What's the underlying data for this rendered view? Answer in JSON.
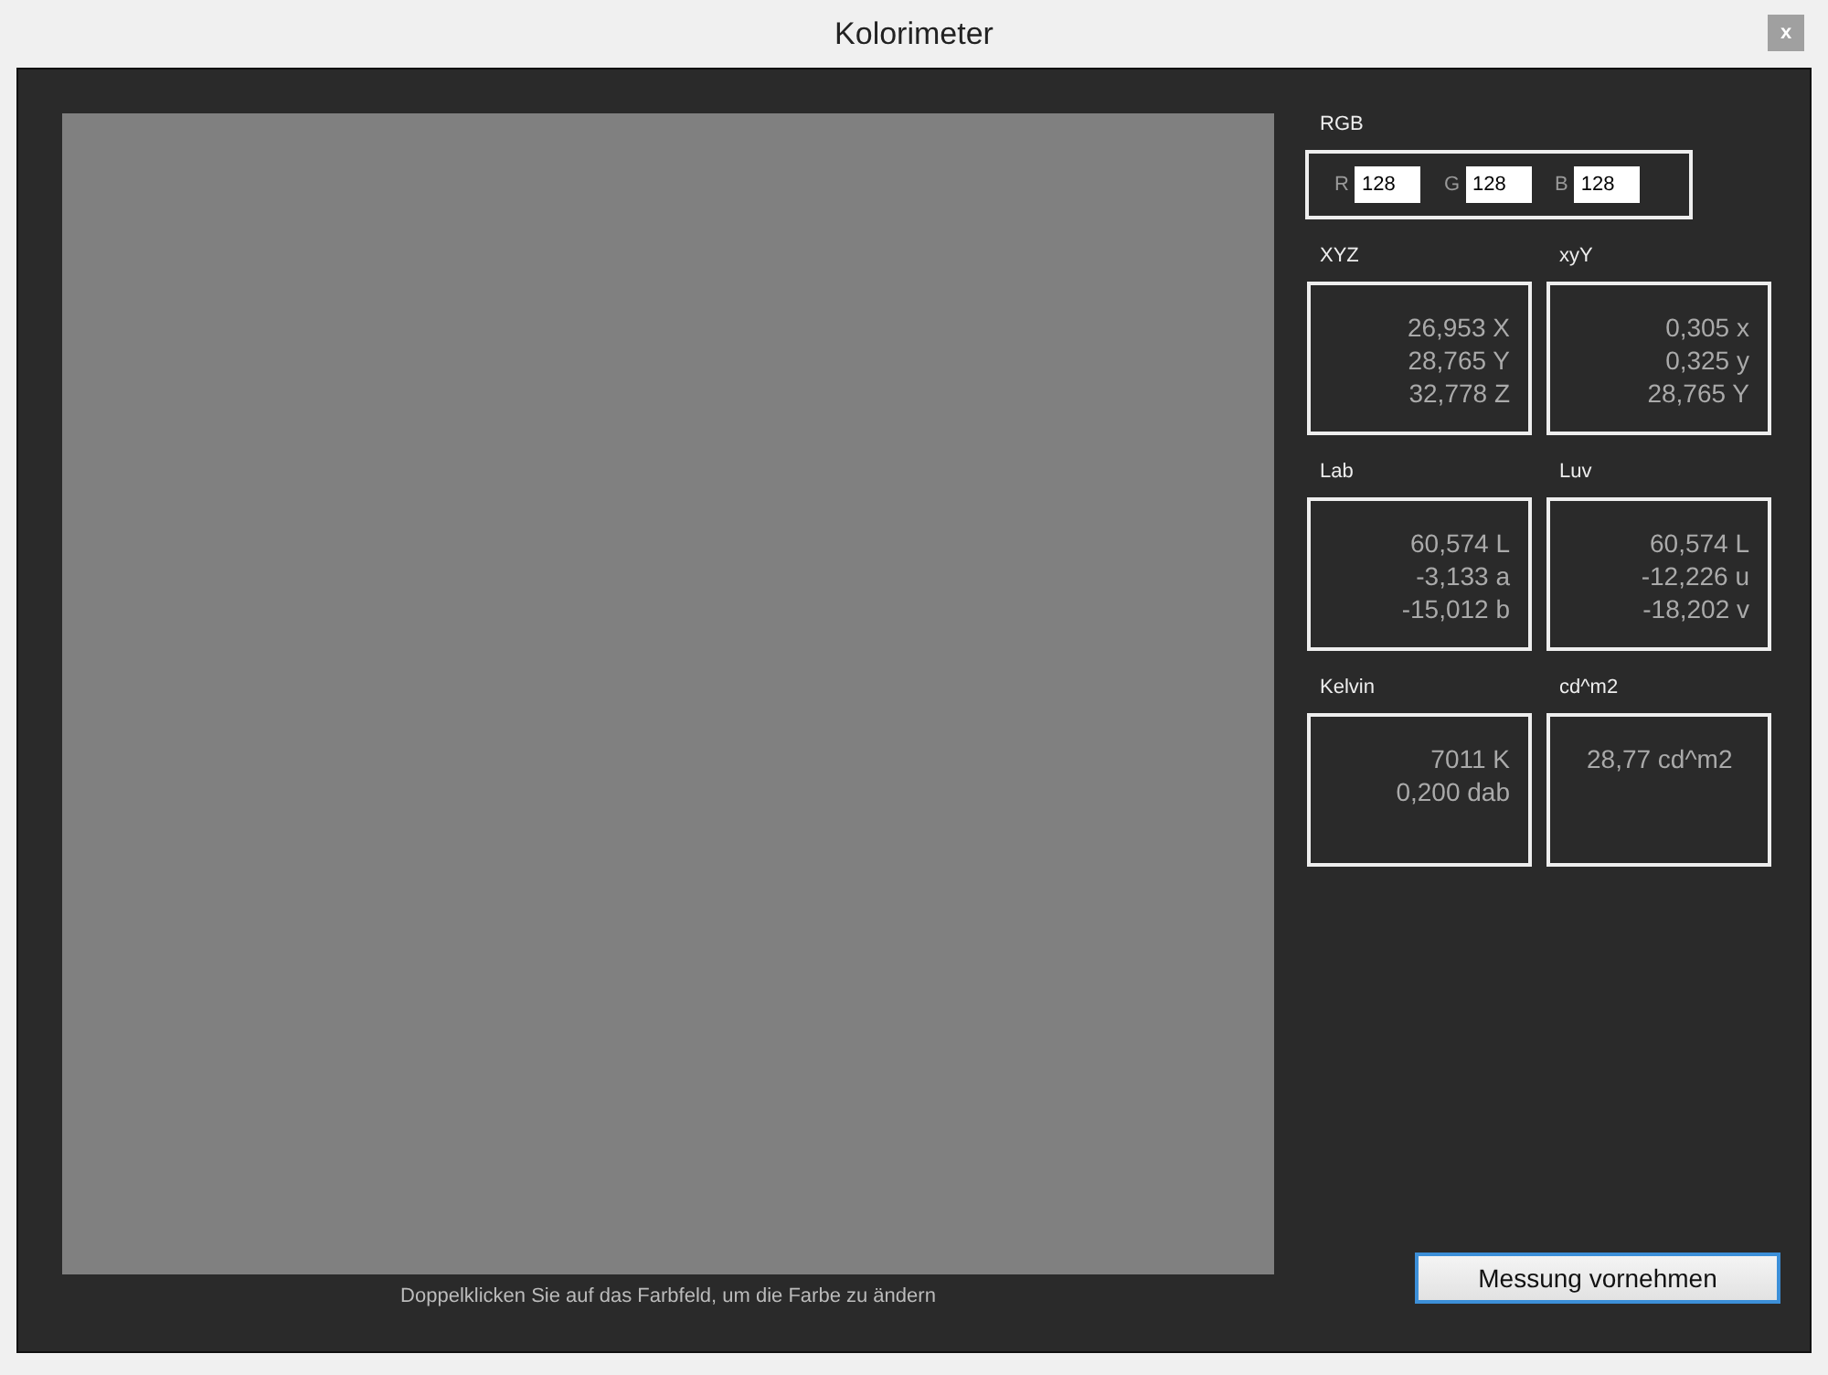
{
  "window": {
    "title": "Kolorimeter",
    "close": "x"
  },
  "swatch": {
    "hint": "Doppelklicken Sie auf das Farbfeld, um die Farbe zu ändern"
  },
  "rgb": {
    "label": "RGB",
    "fields": [
      {
        "label": "R",
        "value": "128"
      },
      {
        "label": "G",
        "value": "128"
      },
      {
        "label": "B",
        "value": "128"
      }
    ]
  },
  "groups": [
    {
      "label": "XYZ",
      "lines": [
        "26,953 X",
        "28,765 Y",
        "32,778 Z"
      ]
    },
    {
      "label": "xyY",
      "lines": [
        "0,305 x",
        "0,325 y",
        "28,765 Y"
      ]
    },
    {
      "label": "Lab",
      "lines": [
        "60,574 L",
        "-3,133 a",
        "-15,012 b"
      ]
    },
    {
      "label": "Luv",
      "lines": [
        "60,574 L",
        "-12,226 u",
        "-18,202 v"
      ]
    },
    {
      "label": "Kelvin",
      "lines": [
        "7011 K",
        "0,200 dab"
      ]
    },
    {
      "label": "cd^m2",
      "lines": [
        "28,77 cd^m2"
      ]
    }
  ],
  "button": "Messung vornehmen"
}
